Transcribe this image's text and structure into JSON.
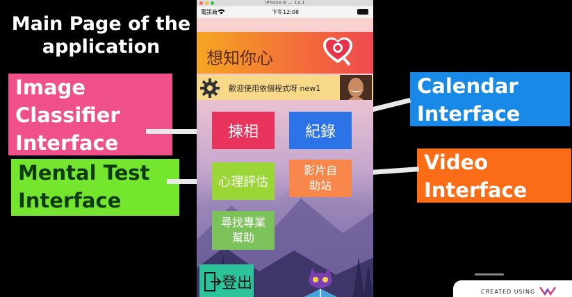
{
  "title": "Main Page of the application",
  "annotations": {
    "image_classifier": "Image Classifier Interface",
    "mental_test": "Mental Test Interface",
    "calendar": "Calendar Interface",
    "video": "Video Interface"
  },
  "simulator": {
    "title": "iPhone 8 — 13.1"
  },
  "status_bar": {
    "carrier": "電訊商",
    "time": "下午12:08"
  },
  "app": {
    "name": "想知你心",
    "welcome": "歡迎使用依個程式呀 new1",
    "tiles": {
      "classify": "揀相",
      "record": "紀錄",
      "mental": "心理評估",
      "video": "影片自助站",
      "help": "尋找專業幫助",
      "logout": "登出"
    }
  },
  "watermark": {
    "text": "CREATED USING"
  },
  "colors": {
    "image_label": "#f0508a",
    "mental_label": "#74e62d",
    "calendar_label": "#1889e6",
    "video_label": "#fa6d16"
  }
}
